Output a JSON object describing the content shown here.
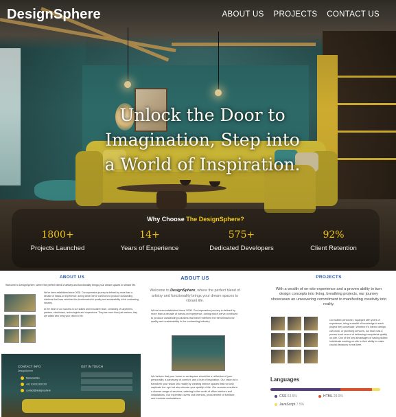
{
  "brand": "DesignSphere",
  "nav": [
    "ABOUT US",
    "PROJECTS",
    "CONTACT US"
  ],
  "hero": {
    "headline_lines": [
      "Unlock the Door to",
      "Imagination, Step into",
      "a World of Inspiration."
    ],
    "why_prefix": "Why Choose",
    "why_brand": "The DesignSphere?",
    "stats": [
      {
        "value": "1800+",
        "label": "Projects Launched"
      },
      {
        "value": "14+",
        "label": "Years of Experience"
      },
      {
        "value": "575+",
        "label": "Dedicated Developers"
      },
      {
        "value": "92%",
        "label": "Client Retention"
      }
    ]
  },
  "left_preview": {
    "title": "ABOUT US",
    "intro": "Welcome to DesignSphere, where the perfect blend of artistry and functionality brings your dream spaces to vibrant life.",
    "body": "We've been established since 2008. Our impressive journey is defined by more than a decade of hands-on experience, during which we've continued to produce outstanding solutions that have redefined the benchmarks for quality and sustainability in the contracting industry.",
    "body2": "At the heart of our success is our skilled and innovative team, consisting of carpenters, painters, electricians, technologists and supervisors. They are more than just workers; they are artists who bring your vision to life."
  },
  "contact": {
    "title": "CONTACT INFO",
    "subtitle": "DesignSphere",
    "git": "GET IN TOUCH",
    "rows": [
      "Maharashtra",
      "+91 XXXXXXXXXX",
      "contact@designsphere"
    ]
  },
  "about": {
    "title": "ABOUT US",
    "intro_pre": "Welcome to ",
    "intro_brand": "DesignSphere",
    "intro_post": ", where the perfect blend of artistry and functionality brings your dream spaces to vibrant life.",
    "p1": "We've been established since 2008. Our impressive journey is defined by more than a decade of hands-on experience, during which we've continued to produce outstanding solutions that have redefined the benchmarks for quality and sustainability in the contracting industry.",
    "p2": "We believe that your home or workspace should be a reflection of your personality, a sanctuary of comfort, and a hub of inspiration. Our vision is to transform your vision into reality by creating interior spaces that not only captivate the eye but also elevate your quality of life. Our success results in a diverse range of services, catering to the world of office interiors and installations. Our expertise covers civil interiors, procurement of furniture, and modular workstations."
  },
  "projects": {
    "title": "PROJECTS",
    "intro": "With a wealth of on-site experience and a proven ability to turn design concepts into living, breathing projects, our journey showcases an unwavering commitment to manifesting creativity into reality.",
    "side": "Our skilled personnel, equipped with years of experience, bring a wealth of knowledge to each project they undertake. Whether it's interior design, civil work, or plumbing services, our team has a proven track record of delivering exceptional quality on-site. One of the key advantages of having skilled individuals working on-site is their ability to make crucial decisions in real time."
  },
  "languages": {
    "title": "Languages",
    "items": [
      {
        "name": "CSS",
        "pct": "63.5%",
        "value": 63.5,
        "color": "#563d7c"
      },
      {
        "name": "HTML",
        "pct": "29.0%",
        "value": 29.0,
        "color": "#e34c26"
      },
      {
        "name": "JavaScript",
        "pct": "7.5%",
        "value": 7.5,
        "color": "#f1e05a"
      }
    ]
  }
}
